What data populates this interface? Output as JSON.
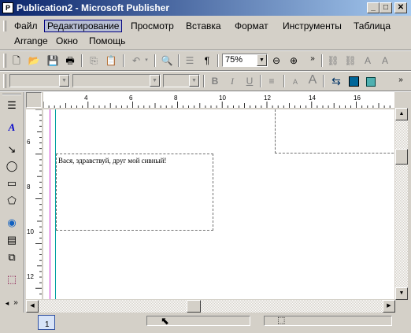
{
  "window": {
    "title": "Publication2 - Microsoft Publisher",
    "app_icon": "P"
  },
  "caption_buttons": {
    "minimize": "_",
    "maximize": "□",
    "close": "✕"
  },
  "menu": {
    "items": [
      "Файл",
      "Редактирование",
      "Просмотр",
      "Вставка",
      "Формат",
      "Инструменты",
      "Таблица",
      "Arrange",
      "Окно",
      "Помощь"
    ],
    "selected": "Редактирование"
  },
  "standard_toolbar": {
    "zoom": "75%",
    "icons": [
      "new-icon",
      "open-icon",
      "save-icon",
      "print-icon",
      "cut-icon",
      "copy-icon",
      "paste-icon",
      "format-painter-icon",
      "undo-icon",
      "redo-icon",
      "print-preview-icon",
      "columns-icon",
      "pilcrow-icon",
      "zoom-out-icon",
      "zoom-in-icon",
      "more-icon",
      "link-icon",
      "unlink-icon",
      "text-fit-icon",
      "text-frame-icon"
    ]
  },
  "format_toolbar": {
    "style": "",
    "font": "",
    "size": "",
    "bold": "B",
    "italic": "I",
    "underline": "U"
  },
  "ruler": {
    "h_labels": [
      "4",
      "6",
      "8",
      "10",
      "12",
      "14",
      "16"
    ],
    "v_labels": [
      "6",
      "8",
      "10",
      "12"
    ]
  },
  "document": {
    "text_frame_content": "Вася, здравствуй, друг мой сивный!"
  },
  "status": {
    "page_number": "1"
  },
  "colors": {
    "title_start": "#0a246a",
    "title_end": "#a6caf0",
    "face": "#d4d0c8",
    "guide_margin": "#cc33cc",
    "guide_column": "#00a0a0"
  }
}
